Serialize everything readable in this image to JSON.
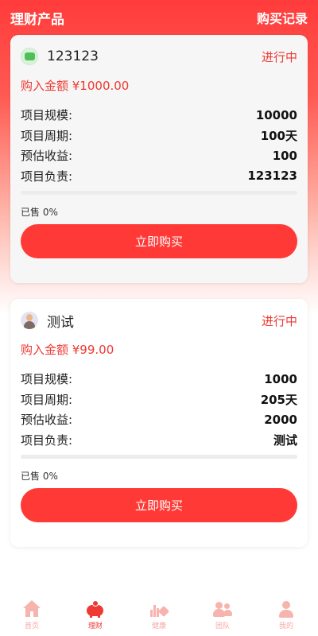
{
  "header": {
    "title": "理财产品",
    "record_link": "购买记录"
  },
  "products": [
    {
      "name": "123123",
      "status": "进行中",
      "amount": "购入金额 ¥1000.00",
      "rows": [
        {
          "label": "项目规模:",
          "value": "10000"
        },
        {
          "label": "项目周期:",
          "value": "100天"
        },
        {
          "label": "预估收益:",
          "value": "100"
        },
        {
          "label": "项目负责:",
          "value": "123123"
        }
      ],
      "sold_percent": 0,
      "sold_text": "已售 0%",
      "button": "立即购买",
      "avatar_icon": "green-image-icon"
    },
    {
      "name": "测试",
      "status": "进行中",
      "amount": "购入金额 ¥99.00",
      "rows": [
        {
          "label": "项目规模:",
          "value": "1000"
        },
        {
          "label": "项目周期:",
          "value": "205天"
        },
        {
          "label": "预估收益:",
          "value": "2000"
        },
        {
          "label": "项目负责:",
          "value": "测试"
        }
      ],
      "sold_percent": 0,
      "sold_text": "已售 0%",
      "button": "立即购买",
      "avatar_icon": "person-avatar-icon"
    }
  ],
  "tabbar": {
    "active": 1,
    "items": [
      {
        "label": "首页",
        "icon": "home-icon"
      },
      {
        "label": "理财",
        "icon": "piggy-bank-icon"
      },
      {
        "label": "健康",
        "icon": "health-icon"
      },
      {
        "label": "团队",
        "icon": "team-icon"
      },
      {
        "label": "我的",
        "icon": "user-icon"
      }
    ]
  },
  "colors": {
    "accent": "#ee3a32",
    "button": "#ff3a36",
    "tab_inactive": "#f5a9a4"
  }
}
